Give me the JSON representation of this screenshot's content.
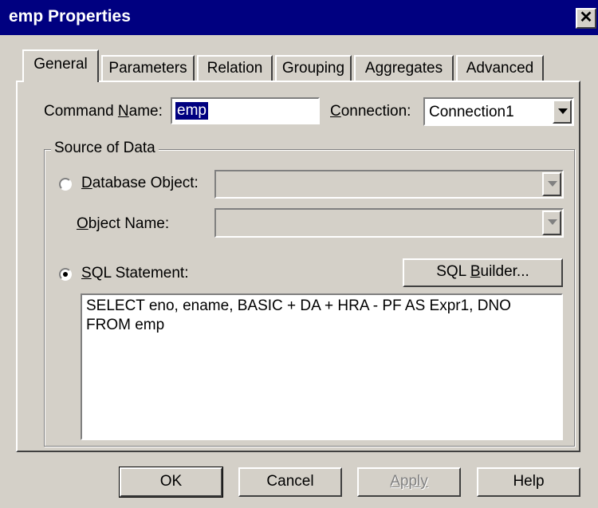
{
  "window": {
    "title": "emp Properties",
    "close_glyph": "✕"
  },
  "tabs": [
    {
      "label": "General",
      "active": true
    },
    {
      "label": "Parameters"
    },
    {
      "label": "Relation"
    },
    {
      "label": "Grouping"
    },
    {
      "label": "Aggregates"
    },
    {
      "label": "Advanced"
    }
  ],
  "general": {
    "command_name_label_pre": "Command ",
    "command_name_label_u": "N",
    "command_name_label_post": "ame:",
    "command_name_value": "emp",
    "connection_label_u": "C",
    "connection_label_post": "onnection:",
    "connection_value": "Connection1",
    "source_group_title": "Source of Data",
    "database_object_label_u": "D",
    "database_object_label_post": "atabase Object:",
    "database_object_value": "",
    "object_name_label_u": "O",
    "object_name_label_post": "bject Name:",
    "object_name_value": "",
    "sql_statement_label_u": "S",
    "sql_statement_label_post": "QL Statement:",
    "sql_builder_pre": "SQL ",
    "sql_builder_u": "B",
    "sql_builder_post": "uilder...",
    "sql_text": "SELECT eno, ename, BASIC + DA + HRA - PF AS Expr1, DNO\nFROM emp",
    "selected_source": "sql"
  },
  "footer": {
    "ok_label": "OK",
    "cancel_label": "Cancel",
    "apply_label": "Apply",
    "help_label": "Help"
  },
  "icons": [
    "close-icon",
    "dropdown-arrow-icon",
    "radio-icon"
  ],
  "colors": {
    "titlebar": "#000080",
    "face": "#d4d0c8",
    "selection": "#000080"
  }
}
